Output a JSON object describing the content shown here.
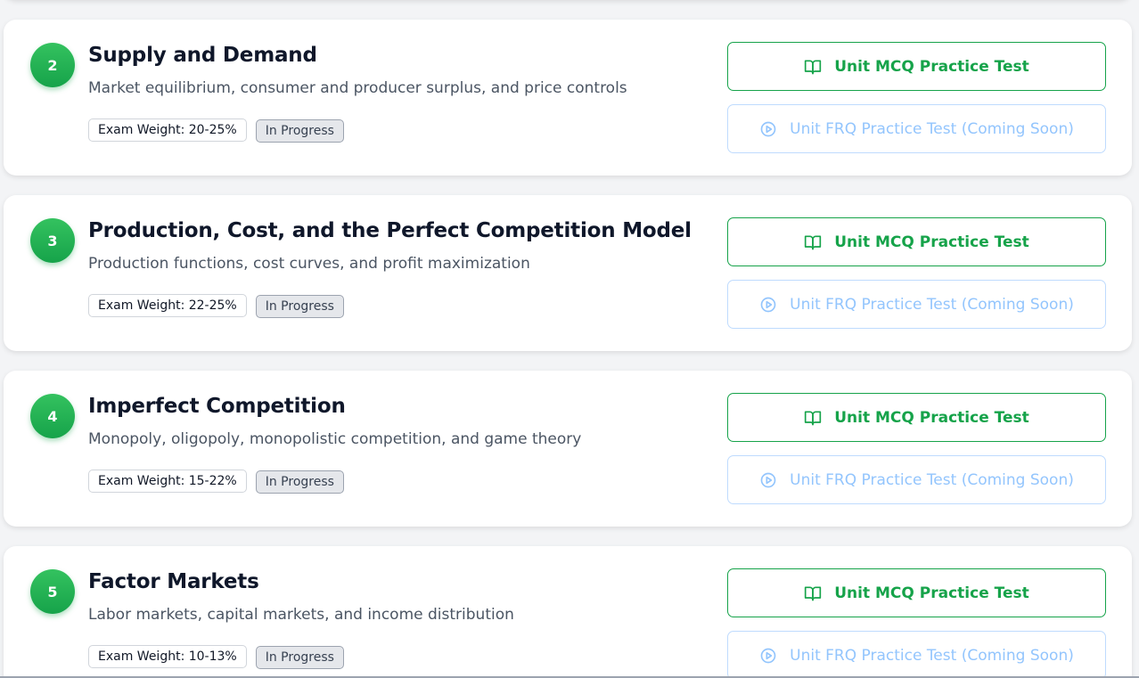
{
  "units": [
    {
      "number": "2",
      "title": "Supply and Demand",
      "description": "Market equilibrium, consumer and producer surplus, and price controls",
      "weight": "Exam Weight: 20-25%",
      "status": "In Progress",
      "mcq_label": "Unit MCQ Practice Test",
      "frq_label": "Unit FRQ Practice Test (Coming Soon)"
    },
    {
      "number": "3",
      "title": "Production, Cost, and the Perfect Competition Model",
      "description": "Production functions, cost curves, and profit maximization",
      "weight": "Exam Weight: 22-25%",
      "status": "In Progress",
      "mcq_label": "Unit MCQ Practice Test",
      "frq_label": "Unit FRQ Practice Test (Coming Soon)"
    },
    {
      "number": "4",
      "title": "Imperfect Competition",
      "description": "Monopoly, oligopoly, monopolistic competition, and game theory",
      "weight": "Exam Weight: 15-22%",
      "status": "In Progress",
      "mcq_label": "Unit MCQ Practice Test",
      "frq_label": "Unit FRQ Practice Test (Coming Soon)"
    },
    {
      "number": "5",
      "title": "Factor Markets",
      "description": "Labor markets, capital markets, and income distribution",
      "weight": "Exam Weight: 10-13%",
      "status": "In Progress",
      "mcq_label": "Unit MCQ Practice Test",
      "frq_label": "Unit FRQ Practice Test (Coming Soon)"
    }
  ],
  "icons": {
    "mcq": "book-open-icon",
    "frq": "play-circle-icon"
  },
  "colors": {
    "accent_green": "#16a34a",
    "frq_blue": "#93c5fd",
    "title": "#0f172a"
  }
}
